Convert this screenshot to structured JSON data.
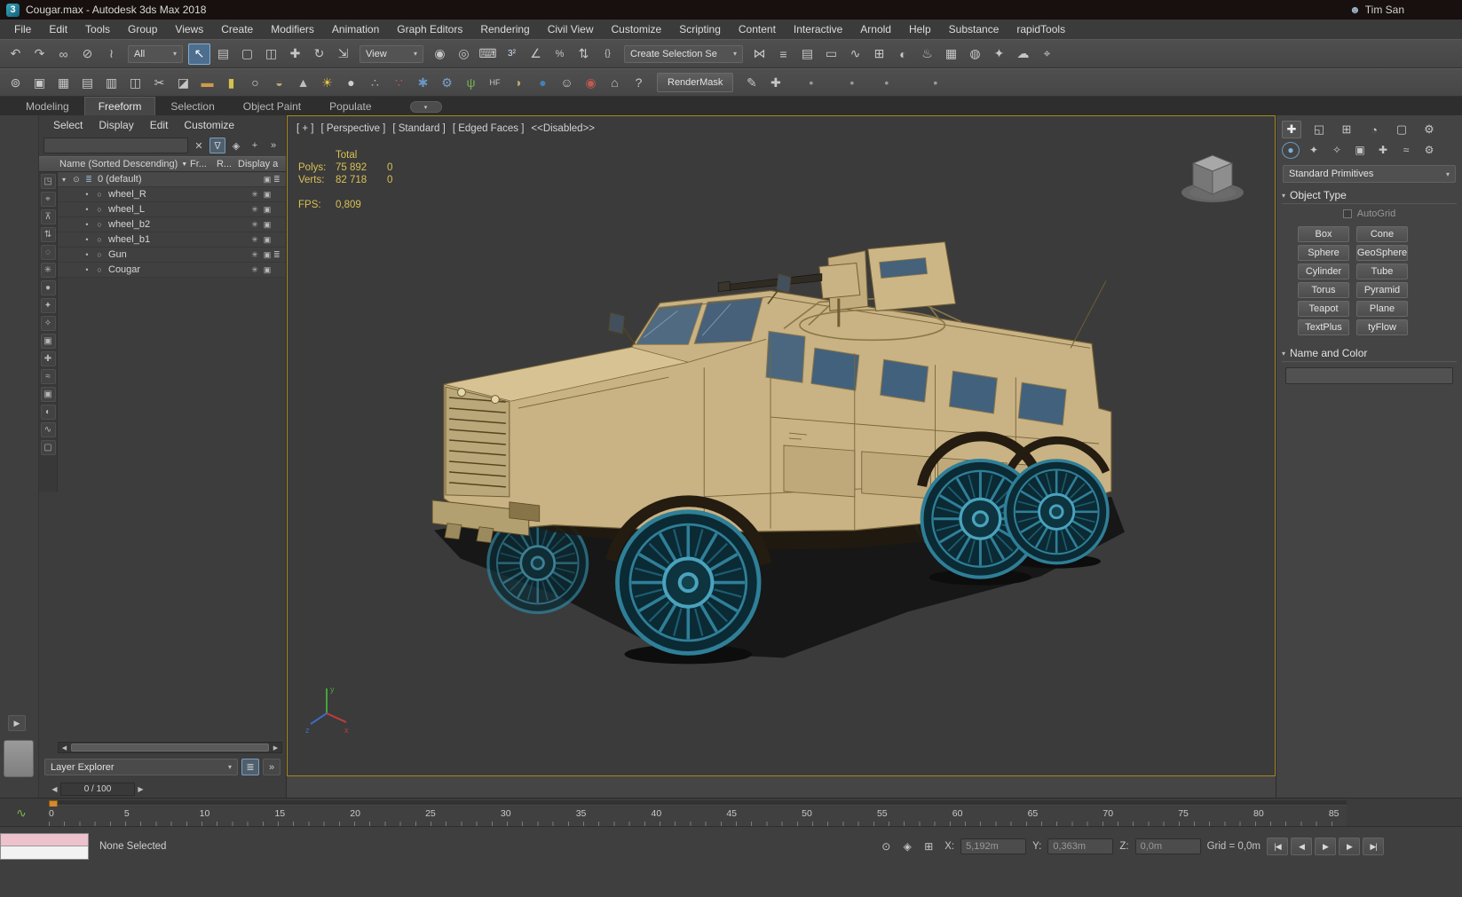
{
  "colors": {
    "viewport_border": "#a8871e",
    "selection_highlight": "#4d6e8e",
    "stats_text": "#d9c155",
    "wheel_teal": "#2f7f98",
    "body_tan": "#c9b283",
    "listener_pink": "#eec2cd"
  },
  "titlebar": {
    "logo": "3",
    "title": "Cougar.max - Autodesk 3ds Max 2018",
    "user": "Tim San"
  },
  "menubar": {
    "items": [
      "File",
      "Edit",
      "Tools",
      "Group",
      "Views",
      "Create",
      "Modifiers",
      "Animation",
      "Graph Editors",
      "Rendering",
      "Civil View",
      "Customize",
      "Scripting",
      "Content",
      "Interactive",
      "Arnold",
      "Help",
      "Substance",
      "rapidTools"
    ]
  },
  "toolbar_main": {
    "seg_a": [
      {
        "n": "undo-icon",
        "g": "↶"
      },
      {
        "n": "redo-icon",
        "g": "↷"
      },
      {
        "n": "select-and-link-icon",
        "g": "∞"
      },
      {
        "n": "unlink-selection-icon",
        "g": "⊘"
      },
      {
        "n": "bind-to-spacewarp-icon",
        "g": "≀"
      }
    ],
    "selection_filter": "All",
    "seg_b": [
      {
        "n": "select-object-icon",
        "g": "↖",
        "css": "background:#4d6e8e;box-shadow:inset 0 0 0 1px #85aed0;color:#ffffff"
      },
      {
        "n": "select-by-name-icon",
        "g": "▤"
      },
      {
        "n": "rect-selection-region-icon",
        "g": "▢"
      },
      {
        "n": "window-crossing-icon",
        "g": "◫"
      },
      {
        "n": "select-and-move-icon",
        "g": "✚"
      },
      {
        "n": "select-and-rotate-icon",
        "g": "↻"
      },
      {
        "n": "select-and-scale-icon",
        "g": "⇲"
      }
    ],
    "reference_coord": "View",
    "seg_c": [
      {
        "n": "use-pivot-center-icon",
        "g": "◉"
      },
      {
        "n": "select-and-manipulate-icon",
        "g": "◎"
      },
      {
        "n": "keyboard-override-icon",
        "g": "⌨"
      },
      {
        "n": "snap-toggle-icon",
        "g": "3²",
        "css": "font-size:10px;color:#cfe0ef"
      },
      {
        "n": "angle-snap-icon",
        "g": "∠"
      },
      {
        "n": "percent-snap-icon",
        "g": "%",
        "css": "font-size:11px"
      },
      {
        "n": "spinner-snap-icon",
        "g": "⇅"
      },
      {
        "n": "edit-named-selections-icon",
        "g": "{}",
        "css": "font-size:10px"
      }
    ],
    "named_selection": "Create Selection Se",
    "seg_d": [
      {
        "n": "mirror-icon",
        "g": "⋈"
      },
      {
        "n": "align-icon",
        "g": "≡"
      },
      {
        "n": "layer-explorer-toggle-icon",
        "g": "▤"
      },
      {
        "n": "ribbon-toggle-icon",
        "g": "▭"
      },
      {
        "n": "curve-editor-icon",
        "g": "∿"
      },
      {
        "n": "schematic-view-icon",
        "g": "⊞"
      },
      {
        "n": "material-editor-icon",
        "g": "◐"
      },
      {
        "n": "render-setup-icon",
        "g": "♨"
      },
      {
        "n": "rendered-frame-icon",
        "g": "▦"
      },
      {
        "n": "render-production-icon",
        "g": "◍"
      },
      {
        "n": "lighting-analysis-icon",
        "g": "✦"
      },
      {
        "n": "render-in-cloud-icon",
        "g": "☁"
      },
      {
        "n": "civil-view-target-icon",
        "g": "⌖"
      }
    ]
  },
  "toolbar_extra": {
    "seg_a": [
      {
        "n": "world-icon",
        "g": "⊚"
      },
      {
        "n": "image-icon",
        "g": "▣"
      },
      {
        "n": "grid-icon",
        "g": "▦"
      },
      {
        "n": "table-icon",
        "g": "▤"
      },
      {
        "n": "notes-icon",
        "g": "▥"
      },
      {
        "n": "camera-track-icon",
        "g": "◫"
      },
      {
        "n": "scissors-icon",
        "g": "✂"
      },
      {
        "n": "clapperboard-icon",
        "g": "◪"
      },
      {
        "n": "rect-shape-icon",
        "g": "▬",
        "css": "color:#cf9a4c"
      },
      {
        "n": "capsule-shape-icon",
        "g": "▮",
        "css": "color:#d6c14e"
      },
      {
        "n": "circle-shape-icon",
        "g": "○",
        "css": "color:#d9d9d9"
      },
      {
        "n": "striped-sphere-icon",
        "g": "◒",
        "css": "color:#c2a470"
      },
      {
        "n": "cone-icon",
        "g": "▲",
        "css": "color:#bdbdbd"
      },
      {
        "n": "sun-icon",
        "g": "☀",
        "css": "color:#e6c23c"
      },
      {
        "n": "sphere-icon",
        "g": "●",
        "css": "color:#cfcfcf"
      },
      {
        "n": "particles-icon",
        "g": "∴",
        "css": "color:#b8b8b8"
      },
      {
        "n": "fluid-drops-icon",
        "g": "∵",
        "css": "color:#c05a50"
      },
      {
        "n": "atom-icon",
        "g": "✱",
        "css": "color:#6b95c4"
      },
      {
        "n": "gear-icon",
        "g": "⚙",
        "css": "color:#7aa2cc"
      },
      {
        "n": "grass-icon",
        "g": "ψ",
        "css": "color:#74b14f"
      },
      {
        "n": "hair-fur-icon",
        "g": "HF",
        "css": "font-size:9px"
      },
      {
        "n": "shell-icon",
        "g": "◗",
        "css": "color:#c2a470"
      },
      {
        "n": "blue-sphere-icon",
        "g": "●",
        "css": "color:#4381b5"
      },
      {
        "n": "populate-icon",
        "g": "☺",
        "css": "color:#c8c8c8"
      },
      {
        "n": "record-icon",
        "g": "◉",
        "css": "color:#c05a50"
      },
      {
        "n": "building-icon",
        "g": "⌂"
      },
      {
        "n": "help-icon",
        "g": "?"
      }
    ],
    "rendermask_label": "RenderMask",
    "seg_b": [
      {
        "n": "paint-tool-icon",
        "g": "✎"
      },
      {
        "n": "transform-cross-icon",
        "g": "✚"
      }
    ],
    "dots": [
      {
        "n": "toolbar-dot-icon",
        "g": "•",
        "css": "margin:0 13px;color:#9a9a9a"
      },
      {
        "n": "toolbar-dot-icon",
        "g": "•",
        "css": "margin:0 6px;color:#9a9a9a"
      },
      {
        "n": "toolbar-dot-icon",
        "g": "•",
        "css": "margin:0 6px;color:#9a9a9a"
      },
      {
        "n": "toolbar-dot-icon",
        "g": "•",
        "css": "margin:0 22px;color:#9a9a9a"
      }
    ]
  },
  "ribbon": {
    "tabs": [
      {
        "label": "Modeling"
      },
      {
        "label": "Freeform",
        "css": "background:#474747;color:#eaeaea;border:1px solid #5a5a5a;border-bottom:none"
      },
      {
        "label": "Selection"
      },
      {
        "label": "Object Paint"
      },
      {
        "label": "Populate"
      }
    ]
  },
  "glyphs": {
    "dropdown": "▾",
    "sort": "▼",
    "clear": "✕",
    "filter": "∇",
    "lock": "◈",
    "add": "+",
    "overflow": "»",
    "expand": "▾",
    "eye": "⊙",
    "layer": "≣",
    "dot": "•",
    "ring": "○",
    "left": "◀",
    "right": "▶",
    "wave": "∿",
    "user": "☻",
    "pill": "▾",
    "panel_expand": "▶"
  },
  "explorer": {
    "menu": [
      "Select",
      "Display",
      "Edit",
      "Customize"
    ],
    "columns": {
      "name": "Name (Sorted Descending)",
      "frozen": "Fr...",
      "render": "R...",
      "display": "Display a"
    },
    "strip": [
      {
        "n": "lock-cell-editing-icon",
        "g": "◳"
      },
      {
        "n": "pick-parent-icon",
        "g": "⌖"
      },
      {
        "n": "pin-explorer-icon",
        "g": "⊼"
      },
      {
        "n": "sync-selection-icon",
        "g": "⇅"
      },
      {
        "n": "display-hidden-icon",
        "g": "◌"
      },
      {
        "n": "display-frozen-icon",
        "g": "✳"
      },
      {
        "n": "display-geometry-icon",
        "g": "●"
      },
      {
        "n": "display-shapes-icon",
        "g": "✦"
      },
      {
        "n": "display-lights-icon",
        "g": "✧"
      },
      {
        "n": "display-cameras-icon",
        "g": "▣"
      },
      {
        "n": "display-helpers-icon",
        "g": "✚"
      },
      {
        "n": "display-spacewarps-icon",
        "g": "≈"
      },
      {
        "n": "display-groups-icon",
        "g": "▣"
      },
      {
        "n": "display-materials-icon",
        "g": "◐"
      },
      {
        "n": "display-bones-icon",
        "g": "∿"
      },
      {
        "n": "display-containers-icon",
        "g": "▢"
      }
    ],
    "layer_row": {
      "name": "0 (default)",
      "fr": "",
      "r": "▣",
      "disp": "≣"
    },
    "rows": [
      {
        "name": "wheel_R",
        "fr": "✳",
        "r": "▣",
        "disp": ""
      },
      {
        "name": "wheel_L",
        "fr": "✳",
        "r": "▣",
        "disp": ""
      },
      {
        "name": "wheel_b2",
        "fr": "✳",
        "r": "▣",
        "disp": ""
      },
      {
        "name": "wheel_b1",
        "fr": "✳",
        "r": "▣",
        "disp": ""
      },
      {
        "name": "Gun",
        "fr": "✳",
        "r": "▣",
        "disp": "≣"
      },
      {
        "name": "Cougar",
        "fr": "✳",
        "r": "▣",
        "disp": ""
      }
    ],
    "footer_mode": "Layer Explorer",
    "frame_display": "0 / 100"
  },
  "viewport": {
    "label_plus": "[ + ]",
    "label_camera": "[ Perspective ]",
    "label_style": "[ Standard ]",
    "label_shading": "[ Edged Faces ]",
    "label_disabled": "<<Disabled>>",
    "stats": {
      "total": "Total",
      "polys_label": "Polys:",
      "polys": "75 892",
      "polys_sel": "0",
      "verts_label": "Verts:",
      "verts": "82 718",
      "verts_sel": "0",
      "fps_label": "FPS:",
      "fps": "0,809"
    }
  },
  "cmdpanel": {
    "tabs": [
      {
        "n": "tab-create-icon",
        "g": "✚",
        "css": "color:#eeeeee;background:#515151;box-shadow:inset 0 0 0 1px #6a6a6a"
      },
      {
        "n": "tab-modify-icon",
        "g": "◱"
      },
      {
        "n": "tab-hierarchy-icon",
        "g": "⊞"
      },
      {
        "n": "tab-motion-icon",
        "g": "◔"
      },
      {
        "n": "tab-display-icon",
        "g": "▢"
      },
      {
        "n": "tab-utilities-icon",
        "g": "⚙"
      }
    ],
    "categories": [
      {
        "n": "category-geometry-icon",
        "g": "●",
        "css": "color:#7ab3e0;box-shadow:inset 0 0 0 1px #6d9cc4;border-radius:50%"
      },
      {
        "n": "category-shapes-icon",
        "g": "✦"
      },
      {
        "n": "category-lights-icon",
        "g": "✧"
      },
      {
        "n": "category-cameras-icon",
        "g": "▣"
      },
      {
        "n": "category-helpers-icon",
        "g": "✚"
      },
      {
        "n": "category-spacewarps-icon",
        "g": "≈"
      },
      {
        "n": "category-systems-icon",
        "g": "⚙"
      }
    ],
    "object_class_dropdown": "Standard Primitives",
    "rollout_object_type": "Object Type",
    "autogrid": "AutoGrid",
    "primitive_buttons": [
      "Box",
      "Cone",
      "Sphere",
      "GeoSphere",
      "Cylinder",
      "Tube",
      "Torus",
      "Pyramid",
      "Teapot",
      "Plane",
      "TextPlus",
      "tyFlow"
    ],
    "rollout_name_color": "Name and Color"
  },
  "timeline": {
    "labels": [
      "0",
      "5",
      "10",
      "15",
      "20",
      "25",
      "30",
      "35",
      "40",
      "45",
      "50",
      "55",
      "60",
      "65",
      "70",
      "75",
      "80",
      "85"
    ]
  },
  "statusbar": {
    "prompt": "None Selected",
    "icons": [
      {
        "n": "isolate-selection-icon",
        "g": "⊙"
      },
      {
        "n": "selection-lock-icon",
        "g": "◈"
      },
      {
        "n": "transform-type-in-icon",
        "g": "⊞"
      }
    ],
    "x_label": "X:",
    "x_value": "5,192m",
    "y_label": "Y:",
    "y_value": "0,363m",
    "z_label": "Z:",
    "z_value": "0,0m",
    "grid": "Grid = 0,0m",
    "playback": [
      {
        "n": "go-to-start-button",
        "g": "|◀"
      },
      {
        "n": "previous-frame-button",
        "g": "◀"
      },
      {
        "n": "play-button",
        "g": "▶"
      },
      {
        "n": "next-frame-button",
        "g": "▶"
      },
      {
        "n": "go-to-end-button",
        "g": "▶|"
      }
    ]
  }
}
